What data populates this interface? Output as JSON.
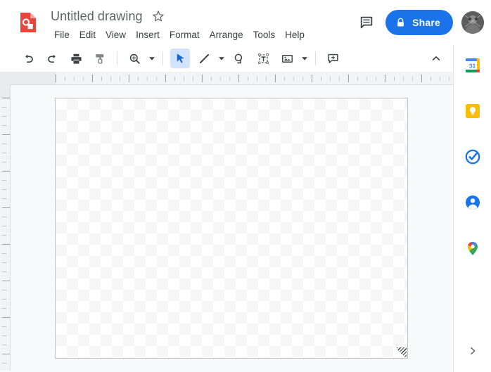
{
  "app": {
    "name": "Google Drawings",
    "logo_icon": "drawings-logo-icon",
    "logo_color": "#e8453c"
  },
  "header": {
    "title": "Untitled drawing",
    "star_icon": "star-outline-icon",
    "comment_icon": "comment-icon",
    "share": {
      "label": "Share",
      "lock_icon": "lock-icon",
      "background": "#1a73e8",
      "text_color": "#ffffff"
    },
    "avatar_icon": "user-avatar",
    "menu": [
      {
        "label": "File"
      },
      {
        "label": "Edit"
      },
      {
        "label": "View"
      },
      {
        "label": "Insert"
      },
      {
        "label": "Format"
      },
      {
        "label": "Arrange"
      },
      {
        "label": "Tools"
      },
      {
        "label": "Help"
      }
    ]
  },
  "toolbar": {
    "items": [
      {
        "name": "undo",
        "icon": "undo-icon",
        "tooltip": "Undo"
      },
      {
        "name": "redo",
        "icon": "redo-icon",
        "tooltip": "Redo"
      },
      {
        "name": "print",
        "icon": "print-icon",
        "tooltip": "Print"
      },
      {
        "name": "paint-format",
        "icon": "paint-format-icon",
        "tooltip": "Paint format"
      },
      {
        "name": "zoom",
        "icon": "zoom-in-icon",
        "tooltip": "Zoom"
      },
      {
        "name": "select",
        "icon": "cursor-arrow-icon",
        "tooltip": "Select",
        "active": true
      },
      {
        "name": "line",
        "icon": "line-icon",
        "tooltip": "Line"
      },
      {
        "name": "shape",
        "icon": "shape-icon",
        "tooltip": "Shape"
      },
      {
        "name": "text-box",
        "icon": "text-box-icon",
        "tooltip": "Text box"
      },
      {
        "name": "image",
        "icon": "image-icon",
        "tooltip": "Image"
      },
      {
        "name": "add-comment",
        "icon": "add-comment-icon",
        "tooltip": "Add comment"
      }
    ],
    "collapse_icon": "chevron-up-icon",
    "active_tool": "select",
    "active_highlight_color": "#d2e3fc"
  },
  "canvas": {
    "background": "transparent-checkerboard",
    "border_color": "#c0c0c0",
    "resize_handle_icon": "resize-grip-icon",
    "content": []
  },
  "rulers": {
    "horizontal": "ruler-horizontal",
    "vertical": "ruler-vertical"
  },
  "side_panel": {
    "apps": [
      {
        "name": "calendar",
        "label": "Calendar",
        "icon": "google-calendar-icon",
        "day": "31"
      },
      {
        "name": "keep",
        "label": "Keep",
        "icon": "google-keep-icon"
      },
      {
        "name": "tasks",
        "label": "Tasks",
        "icon": "google-tasks-icon"
      },
      {
        "name": "contacts",
        "label": "Contacts",
        "icon": "google-contacts-icon"
      },
      {
        "name": "maps",
        "label": "Maps",
        "icon": "google-maps-icon"
      }
    ],
    "expand_icon": "chevron-right-icon"
  }
}
